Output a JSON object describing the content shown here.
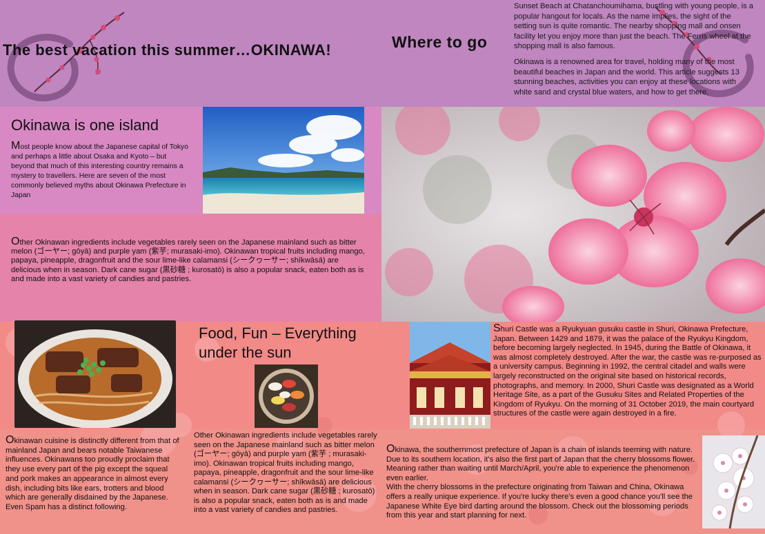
{
  "header": {
    "main_title": "The best vacation this summer…OKINAWA!",
    "where_title": "Where to go",
    "beach_paragraph_1": "Sunset Beach at Chatanchoumihama, bustling with young people, is a popular hangout for locals. As the name implies, the sight of the setting sun is quite romantic. The nearby shopping mall and onsen facility let you enjoy more than just the beach. The Ferris wheel at the shopping mall is also famous.",
    "beach_paragraph_2": "Okinawa is a renowned area for travel, holding many of the most beautiful beaches in Japan and the world. This article suggests 13 stunning beaches, activities you can enjoy at these locations with white sand and crystal blue waters, and how to get there."
  },
  "island_section": {
    "title": "Okinawa is one island",
    "dropcap": "M",
    "body": "ost people know about the Japanese capital of Tokyo and perhaps a little about Osaka and Kyoto – but beyond that much of this interesting country remains a mystery to travellers. Here are seven of the most commonly believed myths about Okinawa Prefecture in Japan"
  },
  "ingredients_section": {
    "dropcap": "O",
    "body": "ther Okinawan ingredients include vegetables rarely seen on the Japanese mainland such as bitter melon (ゴーヤー; gōyā) and purple yam (紫芋; murasaki-imo). Okinawan tropical fruits including mango, papaya, pineapple, dragonfruit and the sour lime-like calamansi (シークヮーサー; shīkwāsā) are delicious when in season. Dark cane sugar (黒砂糖 ; kurosatō) is also a popular snack, eaten both as is and made into a vast variety of candies and pastries."
  },
  "food_section": {
    "title": "Food, Fun – Everything under the sun",
    "cuisine_dropcap": "O",
    "cuisine_body": "kinawan cuisine is distinctly different from that of mainland Japan and bears notable Taiwanese influences. Okinawans too proudly proclaim that they use every part of the pig except the squeal and pork makes an appearance in almost every dish, including bits like ears, trotters and blood which are generally disdained by the Japanese. Even Spam has a distinct following.",
    "ingredients_body": "Other Okinawan ingredients include vegetables rarely seen on the Japanese mainland such as bitter melon (ゴーヤー; gōyā) and purple yam (紫芋 ; murasaki-imo). Okinawan tropical fruits including mango, papaya, pineapple, dragonfruit and the sour lime-like calamansi (シークヮーサー; shīkwāsā) are delicious when in season. Dark cane sugar (黒砂糖 ; kurosatō) is also a popular snack, eaten both as is and made into a vast variety of candies and pastries."
  },
  "castle_section": {
    "dropcap": "S",
    "body": "huri Castle was a Ryukyuan gusuku castle in Shuri, Okinawa Prefecture, Japan. Between 1429 and 1879, it was the palace of the Ryukyu Kingdom, before becoming largely neglected. In 1945, during the Battle of Okinawa, it was almost completely destroyed. After the war, the castle was re-purposed as a university campus. Beginning in 1992, the central citadel and walls were largely reconstructed on the original site based on historical records, photographs, and memory. In 2000, Shuri Castle was designated as a World Heritage Site, as a part of the Gusuku Sites and Related Properties of the Kingdom of Ryukyu. On the morning of 31 October 2019, the main courtyard structures of the castle were again destroyed in a fire."
  },
  "blossom_section": {
    "dropcap": "O",
    "paragraph_1": "kinawa, the southernmost prefecture of Japan is a chain of islands teeming with nature. Due to its southern location, it's also the first part of Japan that the cherry blossoms flower. Meaning rather than waiting until March/April, you're able to experience the phenomenon even earlier.",
    "paragraph_2": "With the cherry blossoms in the prefecture originating from Taiwan and China, Okinawa offers a really unique experience. If you're lucky there's even a good chance you'll see the Japanese White Eye bird darting around the blossom. Check out the blossoming periods from this year and start planning for next."
  },
  "colors": {
    "top_band": "#bf86c0",
    "island_band": "#d889c4",
    "ingredients_band": "#e583aa",
    "bottom_band": "#f28a88"
  },
  "images": {
    "beach_photo": "beach-photo",
    "blossom_photo": "cherry-blossom-photo",
    "noodle_photo": "okinawa-soba-photo",
    "sushi_photo": "sushi-plate-photo",
    "castle_photo": "shuri-castle-photo",
    "white_blossom_photo": "white-blossom-photo"
  }
}
